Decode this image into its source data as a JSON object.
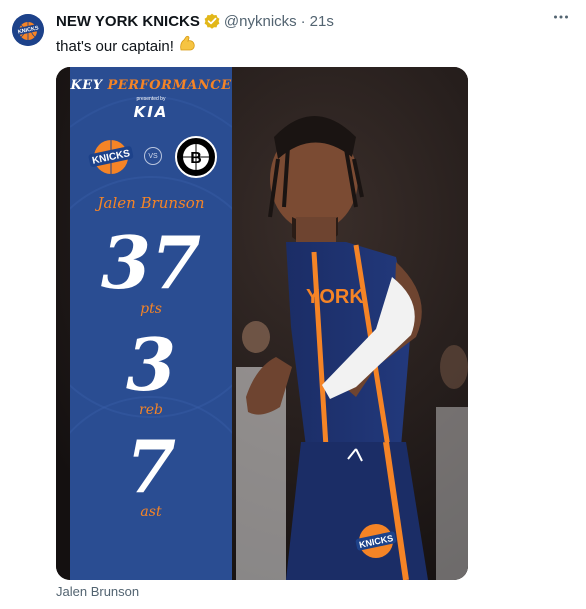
{
  "tweet": {
    "account_name": "NEW YORK KNICKS",
    "handle": "@nyknicks",
    "separator": "·",
    "time": "21s",
    "text": "that's our captain!",
    "emoji_icon": "flexed-biceps-icon",
    "more_icon": "more-options-icon"
  },
  "graphic": {
    "title_key": "KEY",
    "title_rest": "PERFORMANCE",
    "presented_by": "presented by",
    "sponsor": "KIA",
    "vs": "VS",
    "player": "Jalen Brunson",
    "stats": [
      {
        "value": "37",
        "label": "pts"
      },
      {
        "value": "3",
        "label": "reb"
      },
      {
        "value": "7",
        "label": "ast"
      }
    ],
    "team_home_logo_text": "KNICKS",
    "team_away_logo_text": "B"
  },
  "alt_caption": "Jalen Brunson",
  "colors": {
    "knicks_blue": "#2a4d92",
    "knicks_orange": "#f58426",
    "text_primary": "#0f1419",
    "text_secondary": "#536471"
  }
}
